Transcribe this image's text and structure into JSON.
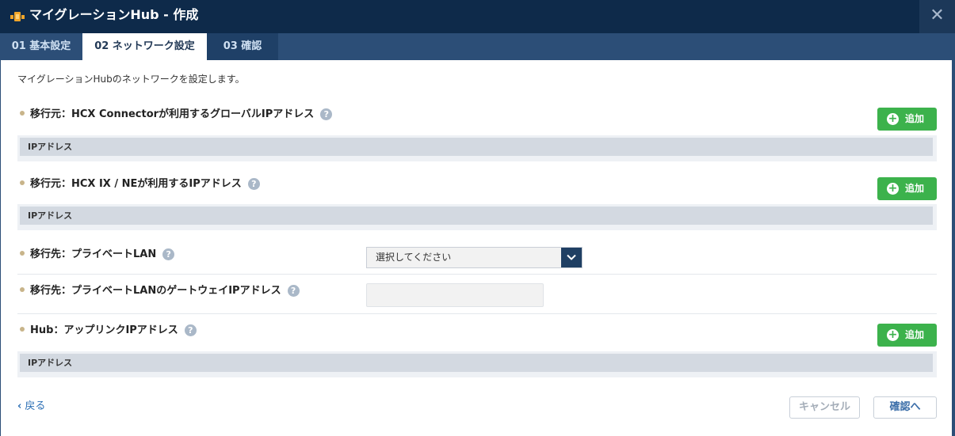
{
  "window": {
    "title": "マイグレーションHub - 作成",
    "close_label": "✕"
  },
  "tabs": [
    {
      "label": "01 基本設定"
    },
    {
      "label": "02 ネットワーク設定"
    },
    {
      "label": "03 確認"
    }
  ],
  "description": "マイグレーションHubのネットワークを設定します。",
  "help_glyph": "?",
  "sections": {
    "hcx_connector": {
      "label": "移行元：HCX Connectorが利用するグローバルIPアドレス",
      "add_label": "追加",
      "column": "IPアドレス"
    },
    "hcx_ix_ne": {
      "label": "移行元：HCX IX / NEが利用するIPアドレス",
      "add_label": "追加",
      "column": "IPアドレス"
    },
    "private_lan": {
      "label": "移行先：プライベートLAN",
      "select_value": "選択してください"
    },
    "gateway_ip": {
      "label": "移行先：プライベートLANのゲートウェイIPアドレス",
      "input_value": ""
    },
    "hub_uplink": {
      "label": "Hub：アップリンクIPアドレス",
      "add_label": "追加",
      "column": "IPアドレス"
    }
  },
  "footer": {
    "back_label": "戻る",
    "cancel_label": "キャンセル",
    "confirm_label": "確認へ"
  },
  "colors": {
    "titlebar": "#0e2a4a",
    "tabbar": "#2c4e77",
    "add_button": "#3cb24c",
    "link": "#2c6fb5"
  }
}
